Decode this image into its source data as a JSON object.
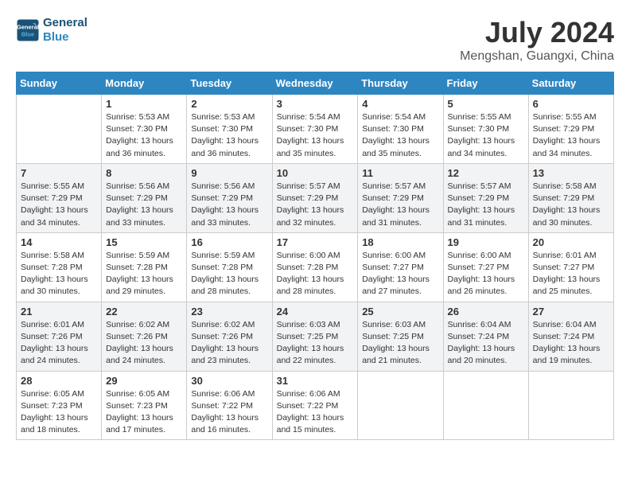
{
  "header": {
    "logo_line1": "General",
    "logo_line2": "Blue",
    "month": "July 2024",
    "location": "Mengshan, Guangxi, China"
  },
  "days_of_week": [
    "Sunday",
    "Monday",
    "Tuesday",
    "Wednesday",
    "Thursday",
    "Friday",
    "Saturday"
  ],
  "weeks": [
    [
      {
        "day": "",
        "sunrise": "",
        "sunset": "",
        "daylight": ""
      },
      {
        "day": "1",
        "sunrise": "Sunrise: 5:53 AM",
        "sunset": "Sunset: 7:30 PM",
        "daylight": "Daylight: 13 hours and 36 minutes."
      },
      {
        "day": "2",
        "sunrise": "Sunrise: 5:53 AM",
        "sunset": "Sunset: 7:30 PM",
        "daylight": "Daylight: 13 hours and 36 minutes."
      },
      {
        "day": "3",
        "sunrise": "Sunrise: 5:54 AM",
        "sunset": "Sunset: 7:30 PM",
        "daylight": "Daylight: 13 hours and 35 minutes."
      },
      {
        "day": "4",
        "sunrise": "Sunrise: 5:54 AM",
        "sunset": "Sunset: 7:30 PM",
        "daylight": "Daylight: 13 hours and 35 minutes."
      },
      {
        "day": "5",
        "sunrise": "Sunrise: 5:55 AM",
        "sunset": "Sunset: 7:30 PM",
        "daylight": "Daylight: 13 hours and 34 minutes."
      },
      {
        "day": "6",
        "sunrise": "Sunrise: 5:55 AM",
        "sunset": "Sunset: 7:29 PM",
        "daylight": "Daylight: 13 hours and 34 minutes."
      }
    ],
    [
      {
        "day": "7",
        "sunrise": "Sunrise: 5:55 AM",
        "sunset": "Sunset: 7:29 PM",
        "daylight": "Daylight: 13 hours and 34 minutes."
      },
      {
        "day": "8",
        "sunrise": "Sunrise: 5:56 AM",
        "sunset": "Sunset: 7:29 PM",
        "daylight": "Daylight: 13 hours and 33 minutes."
      },
      {
        "day": "9",
        "sunrise": "Sunrise: 5:56 AM",
        "sunset": "Sunset: 7:29 PM",
        "daylight": "Daylight: 13 hours and 33 minutes."
      },
      {
        "day": "10",
        "sunrise": "Sunrise: 5:57 AM",
        "sunset": "Sunset: 7:29 PM",
        "daylight": "Daylight: 13 hours and 32 minutes."
      },
      {
        "day": "11",
        "sunrise": "Sunrise: 5:57 AM",
        "sunset": "Sunset: 7:29 PM",
        "daylight": "Daylight: 13 hours and 31 minutes."
      },
      {
        "day": "12",
        "sunrise": "Sunrise: 5:57 AM",
        "sunset": "Sunset: 7:29 PM",
        "daylight": "Daylight: 13 hours and 31 minutes."
      },
      {
        "day": "13",
        "sunrise": "Sunrise: 5:58 AM",
        "sunset": "Sunset: 7:29 PM",
        "daylight": "Daylight: 13 hours and 30 minutes."
      }
    ],
    [
      {
        "day": "14",
        "sunrise": "Sunrise: 5:58 AM",
        "sunset": "Sunset: 7:28 PM",
        "daylight": "Daylight: 13 hours and 30 minutes."
      },
      {
        "day": "15",
        "sunrise": "Sunrise: 5:59 AM",
        "sunset": "Sunset: 7:28 PM",
        "daylight": "Daylight: 13 hours and 29 minutes."
      },
      {
        "day": "16",
        "sunrise": "Sunrise: 5:59 AM",
        "sunset": "Sunset: 7:28 PM",
        "daylight": "Daylight: 13 hours and 28 minutes."
      },
      {
        "day": "17",
        "sunrise": "Sunrise: 6:00 AM",
        "sunset": "Sunset: 7:28 PM",
        "daylight": "Daylight: 13 hours and 28 minutes."
      },
      {
        "day": "18",
        "sunrise": "Sunrise: 6:00 AM",
        "sunset": "Sunset: 7:27 PM",
        "daylight": "Daylight: 13 hours and 27 minutes."
      },
      {
        "day": "19",
        "sunrise": "Sunrise: 6:00 AM",
        "sunset": "Sunset: 7:27 PM",
        "daylight": "Daylight: 13 hours and 26 minutes."
      },
      {
        "day": "20",
        "sunrise": "Sunrise: 6:01 AM",
        "sunset": "Sunset: 7:27 PM",
        "daylight": "Daylight: 13 hours and 25 minutes."
      }
    ],
    [
      {
        "day": "21",
        "sunrise": "Sunrise: 6:01 AM",
        "sunset": "Sunset: 7:26 PM",
        "daylight": "Daylight: 13 hours and 24 minutes."
      },
      {
        "day": "22",
        "sunrise": "Sunrise: 6:02 AM",
        "sunset": "Sunset: 7:26 PM",
        "daylight": "Daylight: 13 hours and 24 minutes."
      },
      {
        "day": "23",
        "sunrise": "Sunrise: 6:02 AM",
        "sunset": "Sunset: 7:26 PM",
        "daylight": "Daylight: 13 hours and 23 minutes."
      },
      {
        "day": "24",
        "sunrise": "Sunrise: 6:03 AM",
        "sunset": "Sunset: 7:25 PM",
        "daylight": "Daylight: 13 hours and 22 minutes."
      },
      {
        "day": "25",
        "sunrise": "Sunrise: 6:03 AM",
        "sunset": "Sunset: 7:25 PM",
        "daylight": "Daylight: 13 hours and 21 minutes."
      },
      {
        "day": "26",
        "sunrise": "Sunrise: 6:04 AM",
        "sunset": "Sunset: 7:24 PM",
        "daylight": "Daylight: 13 hours and 20 minutes."
      },
      {
        "day": "27",
        "sunrise": "Sunrise: 6:04 AM",
        "sunset": "Sunset: 7:24 PM",
        "daylight": "Daylight: 13 hours and 19 minutes."
      }
    ],
    [
      {
        "day": "28",
        "sunrise": "Sunrise: 6:05 AM",
        "sunset": "Sunset: 7:23 PM",
        "daylight": "Daylight: 13 hours and 18 minutes."
      },
      {
        "day": "29",
        "sunrise": "Sunrise: 6:05 AM",
        "sunset": "Sunset: 7:23 PM",
        "daylight": "Daylight: 13 hours and 17 minutes."
      },
      {
        "day": "30",
        "sunrise": "Sunrise: 6:06 AM",
        "sunset": "Sunset: 7:22 PM",
        "daylight": "Daylight: 13 hours and 16 minutes."
      },
      {
        "day": "31",
        "sunrise": "Sunrise: 6:06 AM",
        "sunset": "Sunset: 7:22 PM",
        "daylight": "Daylight: 13 hours and 15 minutes."
      },
      {
        "day": "",
        "sunrise": "",
        "sunset": "",
        "daylight": ""
      },
      {
        "day": "",
        "sunrise": "",
        "sunset": "",
        "daylight": ""
      },
      {
        "day": "",
        "sunrise": "",
        "sunset": "",
        "daylight": ""
      }
    ]
  ]
}
